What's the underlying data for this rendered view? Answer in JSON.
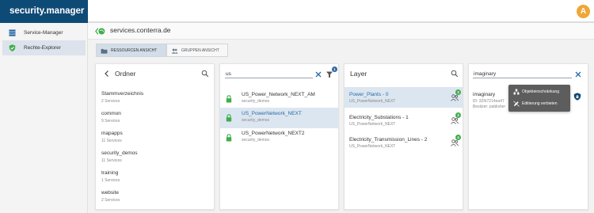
{
  "app": {
    "brand": "security.manager",
    "avatar_letter": "A"
  },
  "sidebar": {
    "items": [
      {
        "label": "Service-Manager",
        "icon": "service-manager-icon"
      },
      {
        "label": "Rechte-Explorer",
        "icon": "shield-check-icon",
        "active": true
      }
    ]
  },
  "breadcrumb": {
    "text": "services.conterra.de"
  },
  "tabs": [
    {
      "label": "RESSOURCEN ANSICHT",
      "active": true
    },
    {
      "label": "GRUPPEN ANSICHT",
      "active": false
    }
  ],
  "ordner": {
    "title": "Ordner",
    "items": [
      {
        "name": "Stammverzeichnis",
        "sub": "2 Services"
      },
      {
        "name": "common",
        "sub": "9 Services"
      },
      {
        "name": "mapapps",
        "sub": "11 Services"
      },
      {
        "name": "security_demos",
        "sub": "11 Services"
      },
      {
        "name": "training",
        "sub": "1 Services"
      },
      {
        "name": "website",
        "sub": "2 Services"
      }
    ]
  },
  "services": {
    "search_value": "us",
    "filter_count": "1",
    "items": [
      {
        "name": "US_Power_Network_NEXT_AM",
        "sub": "security_demos",
        "selected": false
      },
      {
        "name": "US_PowerNetwork_NEXT",
        "sub": "security_demos",
        "selected": true
      },
      {
        "name": "US_PowerNetwork_NEXT2",
        "sub": "security_demos",
        "selected": false
      }
    ]
  },
  "layer": {
    "title": "Layer",
    "items": [
      {
        "name": "Power_Plants - 0",
        "sub": "US_PowerNetwork_NEXT",
        "count": "3",
        "selected": true
      },
      {
        "name": "Electricity_Substations - 1",
        "sub": "US_PowerNetwork_NEXT",
        "count": "3",
        "selected": false
      },
      {
        "name": "Electricity_Transmission_Lines - 2",
        "sub": "US_PowerNetwork_NEXT",
        "count": "4",
        "selected": false
      }
    ]
  },
  "groups": {
    "search_value": "imaginary",
    "item": {
      "name": "imaginary",
      "id_line": "ID: 325t7214ea47",
      "owner_line": "Besitzer: publisher"
    }
  },
  "tooltip": {
    "items": [
      {
        "label": "Objekteinschränkung",
        "icon": "object-restriction-icon"
      },
      {
        "label": "Editierung verbieten",
        "icon": "edit-forbidden-icon"
      }
    ]
  },
  "colors": {
    "brand": "#0e4a76",
    "selected_row": "#dce6f0",
    "badge_green": "#3fae49",
    "lock_green": "#3fae49",
    "avatar": "#f0a637"
  }
}
